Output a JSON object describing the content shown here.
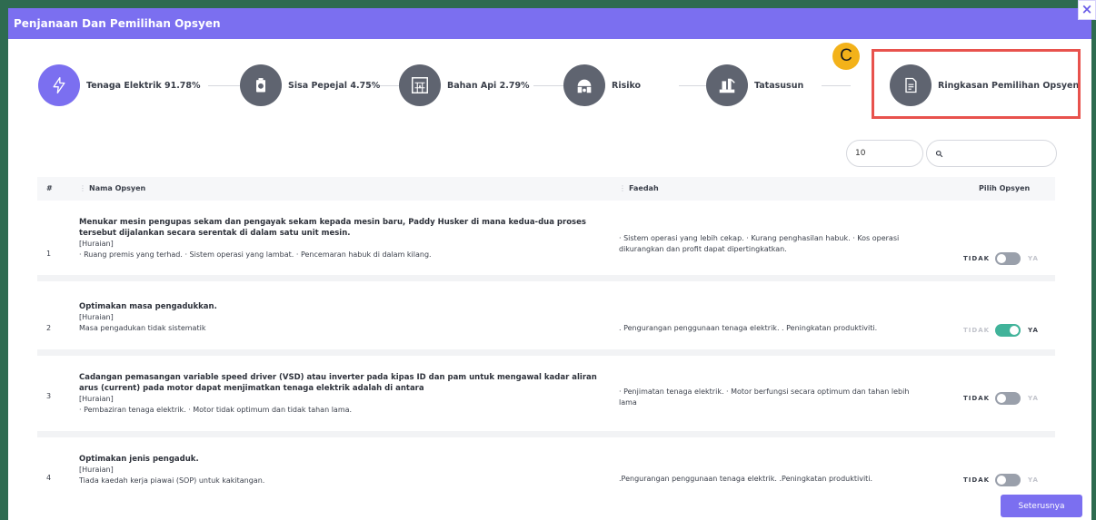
{
  "header": {
    "title": "Penjanaan Dan Pemilihan Opsyen",
    "close_label": "×"
  },
  "annotation": {
    "marker": "C"
  },
  "steps": [
    {
      "label": "Tenaga Elektrik 91.78%",
      "icon": "lightning-icon",
      "active": true
    },
    {
      "label": "Sisa Pepejal 4.75%",
      "icon": "waste-bin-icon",
      "active": false
    },
    {
      "label": "Bahan Api 2.79%",
      "icon": "furnace-icon",
      "active": false
    },
    {
      "label": "Risiko",
      "icon": "risk-icon",
      "active": false
    },
    {
      "label": "Tatasusun",
      "icon": "machinery-icon",
      "active": false
    },
    {
      "label": "Ringkasan Pemilihan Opsyen",
      "icon": "document-icon",
      "active": false
    }
  ],
  "controls": {
    "page_size": "10",
    "search_placeholder": ""
  },
  "table": {
    "headers": {
      "num": "#",
      "name": "Nama Opsyen",
      "benefit": "Faedah",
      "choose": "Pilih Opsyen"
    },
    "rows": [
      {
        "num": "1",
        "title": "Menukar mesin pengupas sekam dan pengayak sekam kepada mesin baru, Paddy Husker di mana kedua-dua proses tersebut dijalankan secara serentak di dalam satu unit mesin.",
        "tag": "[Huraian]",
        "desc": "· Ruang premis yang terhad. · Sistem operasi yang lambat. · Pencemaran habuk di dalam kilang.",
        "benefit": "· Sistem operasi yang lebih cekap. · Kurang penghasilan habuk. · Kos operasi dikurangkan dan profit dapat dipertingkatkan.",
        "selected": false
      },
      {
        "num": "2",
        "title": "Optimakan masa pengadukkan.",
        "tag": "[Huraian]",
        "desc": "Masa pengadukan tidak sistematik",
        "benefit": ". Pengurangan penggunaan tenaga elektrik. . Peningkatan produktiviti.",
        "selected": true
      },
      {
        "num": "3",
        "title": "Cadangan pemasangan variable speed driver (VSD) atau inverter pada kipas ID dan pam untuk mengawal kadar aliran arus (current) pada motor dapat menjimatkan tenaga elektrik adalah di antara",
        "tag": "[Huraian]",
        "desc": "· Pembaziran tenaga elektrik. · Motor tidak optimum dan tidak tahan lama.",
        "benefit": "· Penjimatan tenaga elektrik. · Motor berfungsi secara optimum dan tahan lebih lama",
        "selected": false
      },
      {
        "num": "4",
        "title": "Optimakan jenis pengaduk.",
        "tag": "[Huraian]",
        "desc": "Tiada kaedah kerja piawai (SOP) untuk kakitangan.",
        "benefit": ".Pengurangan penggunaan tenaga elektrik. .Peningkatan produktiviti.",
        "selected": false
      }
    ],
    "toggle_no": "TIDAK",
    "toggle_yes": "YA"
  },
  "footer": {
    "next_label": "Seterusnya"
  },
  "colors": {
    "accent": "#7b6ff0",
    "toggle_on": "#41b39a",
    "highlight": "#e8524d",
    "marker": "#f3b21a"
  }
}
